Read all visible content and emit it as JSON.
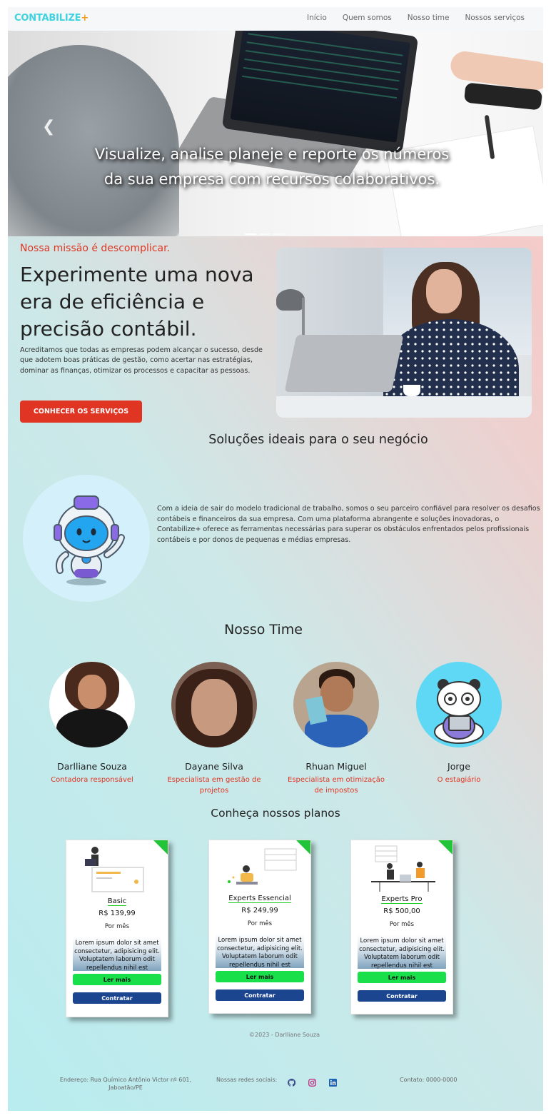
{
  "nav": {
    "logo": "CONTABILIZE",
    "logo_plus": "+",
    "links": [
      "Início",
      "Quem somos",
      "Nosso time",
      "Nossos serviços"
    ]
  },
  "hero": {
    "caption": "Visualize, analise planeje e reporte os números da sua empresa com recursos colaborativos.",
    "prev_icon": "chevron-left-icon",
    "slides": 3
  },
  "mission": {
    "tagline": "Nossa missão é descomplicar.",
    "title": "Experimente uma nova era de eficiência e precisão contábil.",
    "text": "Acreditamos que todas as empresas podem alcançar o sucesso, desde que adotem boas práticas de gestão, como acertar nas estratégias, dominar as finanças, otimizar os processos e capacitar as pessoas.",
    "cta": "CONHECER OS SERVIÇOS"
  },
  "solutions": {
    "title": "Soluções ideais para o seu negócio",
    "text": "Com a ideia de sair do modelo tradicional de trabalho, somos o seu parceiro confiável para resolver os desafios contábeis e financeiros da sua empresa. Com uma plataforma abrangente e soluções inovadoras, o Contabilize+ oferece as ferramentas necessárias para superar os obstáculos enfrentados pelos profissionais contábeis e por donos de pequenas e médias empresas."
  },
  "team": {
    "title": "Nosso Time",
    "members": [
      {
        "name": "Darlliane Souza",
        "role": "Contadora responsável"
      },
      {
        "name": "Dayane Silva",
        "role": "Especialista em gestão de projetos"
      },
      {
        "name": "Rhuan Miguel",
        "role": "Especialista em otimização de impostos"
      },
      {
        "name": "Jorge",
        "role": "O estagiário"
      }
    ]
  },
  "plans": {
    "title": "Conheça nossos planos",
    "items": [
      {
        "name": "Basic",
        "price": "R$ 139,99",
        "period": "Por mês",
        "desc": "Lorem ipsum dolor sit amet consectetur, adipisicing elit. Voluptatem laborum odit repellendus nihil est sapiente",
        "more": "Ler mais",
        "buy": "Contratar"
      },
      {
        "name": "Experts Essencial",
        "price": "R$ 249,99",
        "period": "Por mês",
        "desc": "Lorem ipsum dolor sit amet consectetur, adipisicing elit. Voluptatem laborum odit repellendus nihil est sapiente",
        "more": "Ler mais",
        "buy": "Contratar"
      },
      {
        "name": "Experts Pro",
        "price": "R$ 500,00",
        "period": "Por mês",
        "desc": "Lorem ipsum dolor sit amet consectetur, adipisicing elit. Voluptatem laborum odit repellendus nihil est sapiente",
        "more": "Ler mais",
        "buy": "Contratar"
      }
    ]
  },
  "footer": {
    "copyright": "©2023 - Darlliane Souza",
    "address": "Endereço: Rua Químico Antônio Victor nº 601, Jaboatão/PE",
    "social_label": "Nossas redes sociais:",
    "social_icons": [
      "github-icon",
      "instagram-icon",
      "linkedin-icon"
    ],
    "contact": "Contato: 0000-0000"
  },
  "colors": {
    "brand": "#3fd2df",
    "accent": "#e03523",
    "plus": "#f2a01c",
    "read_more": "#19e04a",
    "hire": "#1c4590"
  }
}
